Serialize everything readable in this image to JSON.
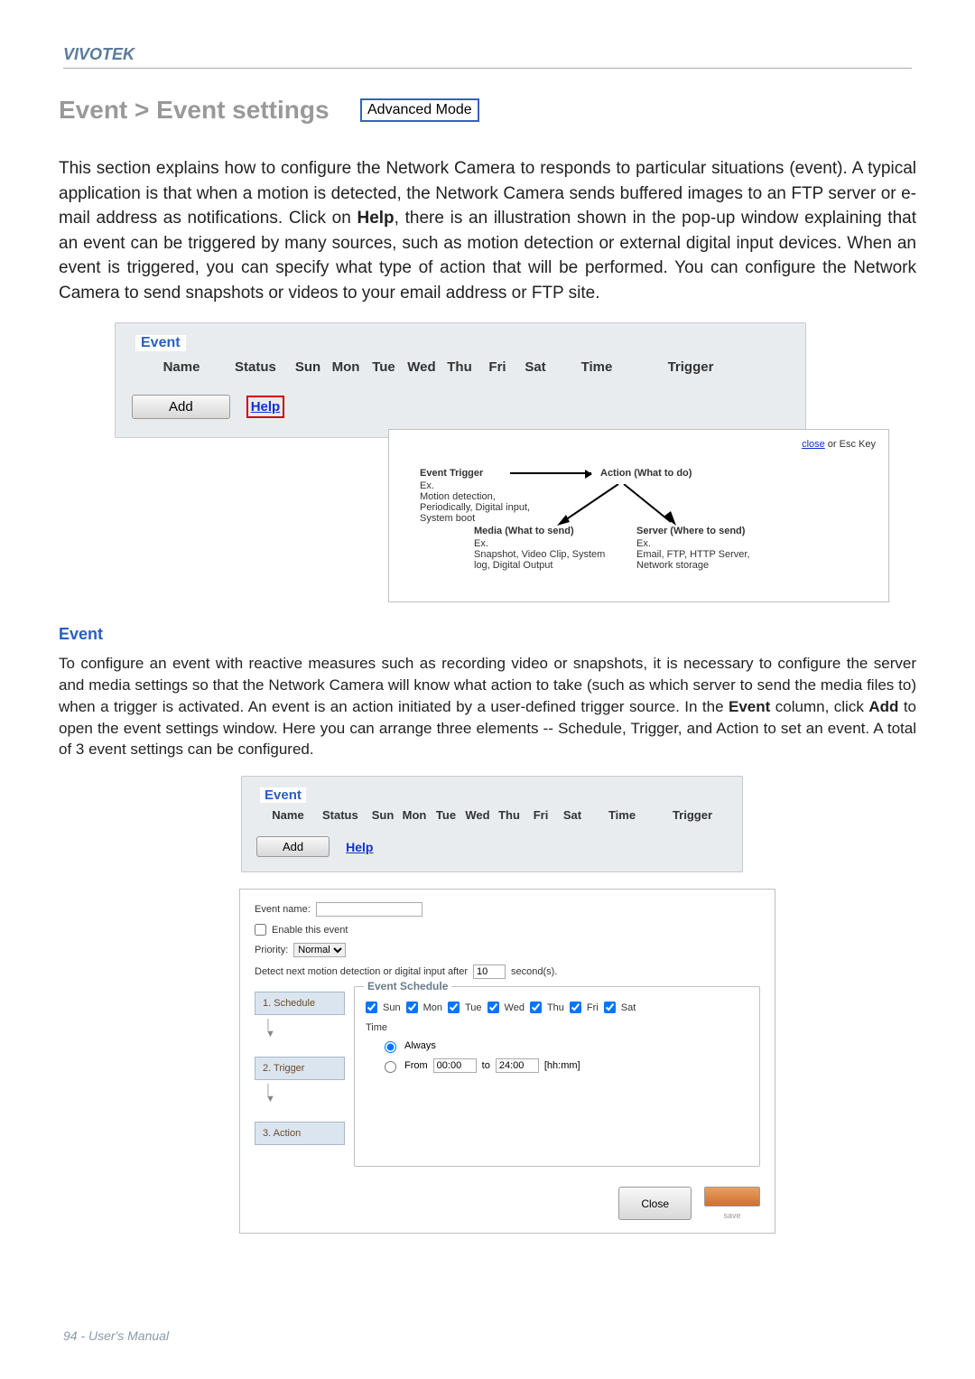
{
  "brand": "VIVOTEK",
  "section_title": "Event > Event settings",
  "mode_badge": "Advanced Mode",
  "intro_para": "This section explains how to configure the Network Camera to responds to particular situations (event). A typical application is that when a motion is detected, the Network Camera sends buffered images to an FTP server or e-mail address as notifications. Click on ",
  "intro_help": "Help",
  "intro_para2": ", there is an illustration shown in the pop-up window explaining that an event can be triggered by many sources, such as motion detection or external digital input devices. When an event is triggered, you can specify what type of action that will be performed. You can configure the Network Camera to send snapshots or videos to your email address or FTP site.",
  "panel1": {
    "title": "Event",
    "headers": {
      "name": "Name",
      "status": "Status",
      "sun": "Sun",
      "mon": "Mon",
      "tue": "Tue",
      "wed": "Wed",
      "thu": "Thu",
      "fri": "Fri",
      "sat": "Sat",
      "time": "Time",
      "trigger": "Trigger"
    },
    "add_label": "Add",
    "help_label": "Help"
  },
  "popup": {
    "close": "close",
    "esc": " or Esc Key",
    "trigger_title": "Event Trigger",
    "trigger_ex": "Ex.",
    "trigger_body": "Motion detection, Periodically, Digital input, System boot",
    "action_title": "Action (What to do)",
    "media_title": "Media (What to send)",
    "media_ex": "Ex.",
    "media_body": "Snapshot, Video Clip, System log, Digital Output",
    "server_title": "Server (Where to send)",
    "server_ex": "Ex.",
    "server_body": "Email, FTP, HTTP Server, Network storage"
  },
  "event_heading": "Event",
  "body_para_a": "To configure an event with reactive measures such as recording video or snapshots, it is necessary to configure the server and media settings so that the Network Camera will know what action to take (such as which server to send the media files to) when a trigger is activated. An event is an action initiated by a user-defined trigger source. In the ",
  "body_para_event": "Event",
  "body_para_b": "  column, click ",
  "body_para_add": "Add",
  "body_para_c": " to open the event settings window. Here you can arrange three elements -- Schedule, Trigger, and Action to set an event. A total of 3 event settings can be configured.",
  "settings": {
    "event_name_label": "Event name:",
    "enable_label": "Enable this event",
    "priority_label": "Priority:",
    "priority_value": "Normal",
    "detect_label_a": "Detect next motion detection or digital input after",
    "detect_value": "10",
    "detect_label_b": "second(s).",
    "schedule_title": "Event Schedule",
    "days": {
      "sun": "Sun",
      "mon": "Mon",
      "tue": "Tue",
      "wed": "Wed",
      "thu": "Thu",
      "fri": "Fri",
      "sat": "Sat"
    },
    "time_label": "Time",
    "always": "Always",
    "from": "From",
    "from_val": "00:00",
    "to": "to",
    "to_val": "24:00",
    "hhmm": "[hh:mm]",
    "steps": {
      "s1": "1. Schedule",
      "s2": "2. Trigger",
      "s3": "3. Action"
    },
    "close_btn": "Close",
    "save_btn": "save"
  },
  "footer": "94 - User's Manual"
}
